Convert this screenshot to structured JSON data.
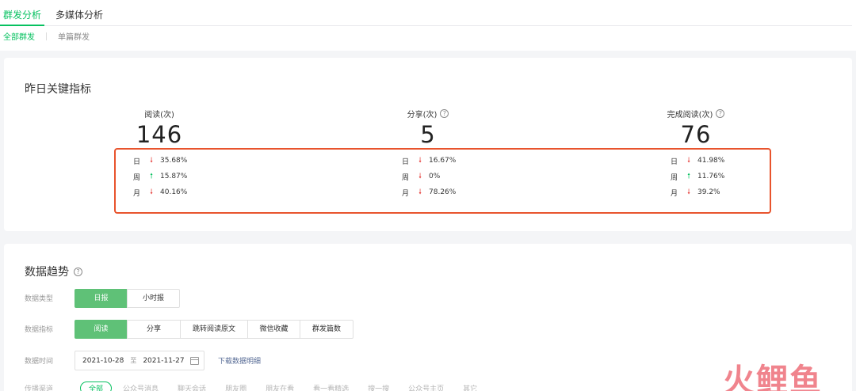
{
  "tabs": [
    {
      "label": "群发分析",
      "active": true
    },
    {
      "label": "多媒体分析",
      "active": false
    }
  ],
  "subtabs": [
    {
      "label": "全部群发",
      "active": true
    },
    {
      "label": "单篇群发",
      "active": false
    }
  ],
  "key_metrics": {
    "title": "昨日关键指标",
    "items": [
      {
        "label": "阅读(次)",
        "value": "146",
        "changes": [
          {
            "period": "日",
            "direction": "down",
            "value": "35.68%"
          },
          {
            "period": "周",
            "direction": "up",
            "value": "15.87%"
          },
          {
            "period": "月",
            "direction": "down",
            "value": "40.16%"
          }
        ]
      },
      {
        "label": "分享(次)",
        "value": "5",
        "changes": [
          {
            "period": "日",
            "direction": "down",
            "value": "16.67%"
          },
          {
            "period": "周",
            "direction": "down",
            "value": "0%"
          },
          {
            "period": "月",
            "direction": "down",
            "value": "78.26%"
          }
        ]
      },
      {
        "label": "完成阅读(次)",
        "value": "76",
        "changes": [
          {
            "period": "日",
            "direction": "down",
            "value": "41.98%"
          },
          {
            "period": "周",
            "direction": "up",
            "value": "11.76%"
          },
          {
            "period": "月",
            "direction": "down",
            "value": "39.2%"
          }
        ]
      }
    ]
  },
  "trend": {
    "title": "数据趋势",
    "type_label": "数据类型",
    "type_options": [
      {
        "label": "日报",
        "active": true
      },
      {
        "label": "小时报",
        "active": false
      }
    ],
    "metric_label": "数据指标",
    "metric_options": [
      {
        "label": "阅读",
        "active": true
      },
      {
        "label": "分享",
        "active": false
      },
      {
        "label": "跳转阅读原文",
        "active": false
      },
      {
        "label": "微信收藏",
        "active": false
      },
      {
        "label": "群发篇数",
        "active": false
      }
    ],
    "time_label": "数据时间",
    "date_start": "2021-10-28",
    "date_sep": "至",
    "date_end": "2021-11-27",
    "download_label": "下载数据明细",
    "source_label": "传播渠道",
    "source_options": [
      "全部",
      "公众号消息",
      "聊天会话",
      "朋友圈",
      "朋友在看",
      "看一看精选",
      "搜一搜",
      "公众号主页",
      "其它"
    ]
  },
  "watermark": "火鲤鱼",
  "colors": {
    "accent": "#07c160",
    "button_active": "#5fc177",
    "arrow_down": "#e64340",
    "arrow_up": "#07c160",
    "highlight_border": "#e8542d",
    "link": "#576b95"
  }
}
